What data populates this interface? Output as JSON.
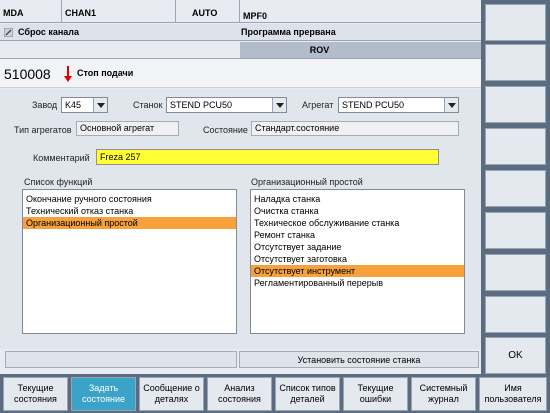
{
  "header": {
    "mode": "MDA",
    "channel": "CHAN1",
    "op_mode": "AUTO",
    "program": "MPF0",
    "reset_text": "Сброс канала",
    "program_status": "Программа прервана",
    "rov": "ROV"
  },
  "alarm": {
    "number": "510008",
    "text": "Стоп подачи"
  },
  "form": {
    "plant_label": "Завод",
    "plant_value": "K45",
    "machine_label": "Станок",
    "machine_value": "STEND PCU50",
    "unit_label": "Агрегат",
    "unit_value": "STEND PCU50",
    "unit_type_label": "Тип агрегатов",
    "unit_type_value": "Основной агрегат",
    "state_label": "Состояние",
    "state_value": "Стандарт.состояние",
    "comment_label": "Комментарий",
    "comment_value": "Freza 257"
  },
  "functions": {
    "title": "Список функций",
    "items": [
      "Окончание ручного состояния",
      "Технический отказ станка",
      "Организационный простой"
    ],
    "selected_index": 2
  },
  "downtime": {
    "title": "Организационный простой",
    "items": [
      "Наладка станка",
      "Очистка станка",
      "Техническое обслуживание станка",
      "Ремонт станка",
      "Отсутствует задание",
      "Отсутствует заготовка",
      "Отсутствует инструмент",
      "Регламентированный перерыв"
    ],
    "selected_index": 6
  },
  "status": {
    "message": "Установить состояние станка"
  },
  "vertical_keys": [
    "",
    "",
    "",
    "",
    "",
    "",
    "",
    "",
    "OK"
  ],
  "horizontal_keys": [
    {
      "label": "Текущие\nсостояния"
    },
    {
      "label": "Задать\nсостояние"
    },
    {
      "label": "Сообщение о\nдеталях"
    },
    {
      "label": "Анализ\nсостояния"
    },
    {
      "label": "Список типов\nдеталей"
    },
    {
      "label": "Текущие\nошибки"
    },
    {
      "label": "Системный\nжурнал"
    },
    {
      "label": "Имя\nпользователя"
    }
  ],
  "colors": {
    "selection": "#f7a13c",
    "comment_bg": "#ffff33",
    "active_key": "#3aa3c7",
    "softkey_frame": "#5b6b80",
    "alarm_arrow": "#e00000"
  }
}
